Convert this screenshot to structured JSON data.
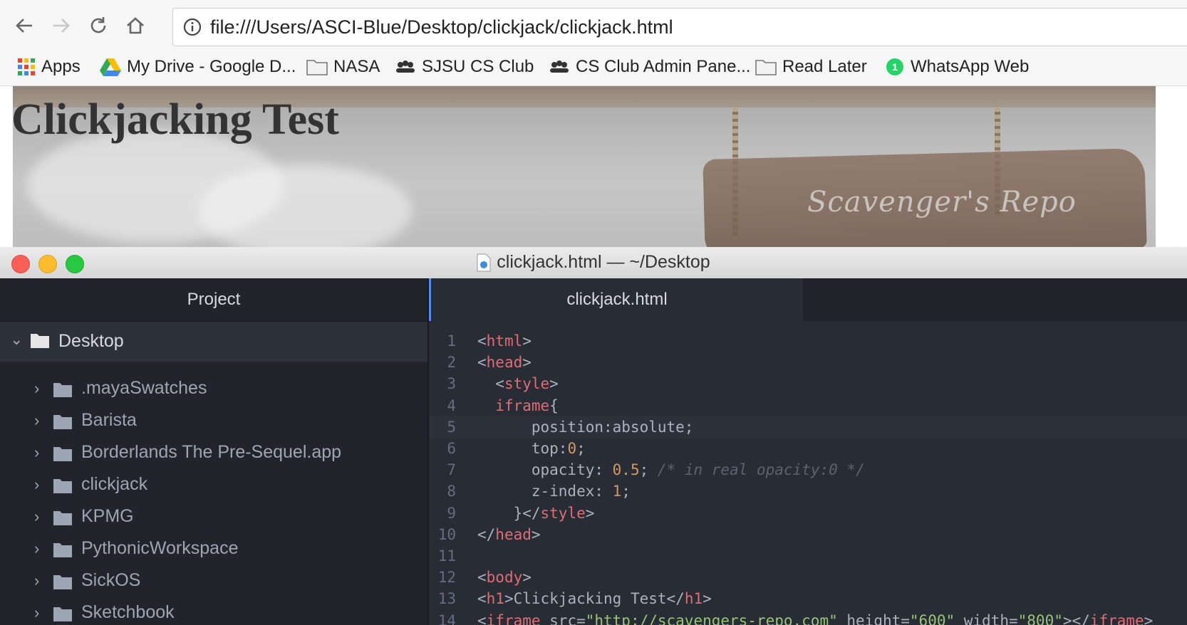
{
  "browser": {
    "url": "file:///Users/ASCI-Blue/Desktop/clickjack/clickjack.html",
    "bookmarks": [
      {
        "label": "Apps",
        "icon": "apps-grid-icon"
      },
      {
        "label": "My Drive - Google D...",
        "icon": "google-drive-icon"
      },
      {
        "label": "NASA",
        "icon": "folder-icon"
      },
      {
        "label": "SJSU CS Club",
        "icon": "club-icon"
      },
      {
        "label": "CS Club Admin Pane...",
        "icon": "club-icon"
      },
      {
        "label": "Read Later",
        "icon": "folder-icon"
      },
      {
        "label": "WhatsApp Web",
        "icon": "whatsapp-icon"
      }
    ]
  },
  "page": {
    "heading": "Clickjacking Test",
    "sign_text": "Scavenger's Repo"
  },
  "editor": {
    "window_title": "clickjack.html — ~/Desktop",
    "project_header": "Project",
    "tab_label": "clickjack.html",
    "tree_root": "Desktop",
    "tree_items": [
      ".mayaSwatches",
      "Barista",
      "Borderlands The Pre-Sequel.app",
      "clickjack",
      "KPMG",
      "PythonicWorkspace",
      "SickOS",
      "Sketchbook"
    ],
    "code_lines": [
      {
        "n": "1",
        "text": "<html>"
      },
      {
        "n": "2",
        "text": "<head>"
      },
      {
        "n": "3",
        "text": "  <style>"
      },
      {
        "n": "4",
        "text": "  iframe{"
      },
      {
        "n": "5",
        "text": "      position:absolute;"
      },
      {
        "n": "6",
        "text": "      top:0;"
      },
      {
        "n": "7",
        "text": "      opacity: 0.5; /* in real opacity:0 */"
      },
      {
        "n": "8",
        "text": "      z-index: 1;"
      },
      {
        "n": "9",
        "text": "    }</style>"
      },
      {
        "n": "10",
        "text": "</head>"
      },
      {
        "n": "11",
        "text": ""
      },
      {
        "n": "12",
        "text": "<body>"
      },
      {
        "n": "13",
        "text": "<h1>Clickjacking Test</h1>"
      },
      {
        "n": "14",
        "text": "<iframe src=\"http://scavengers-repo.com\" height=\"600\" width=\"800\"></iframe>"
      }
    ]
  },
  "colors": {
    "editor_bg": "#282c34",
    "tree_bg": "#21252b",
    "tag": "#e06c75",
    "number": "#d19a66",
    "comment": "#5c6370",
    "accent": "#568af2"
  }
}
